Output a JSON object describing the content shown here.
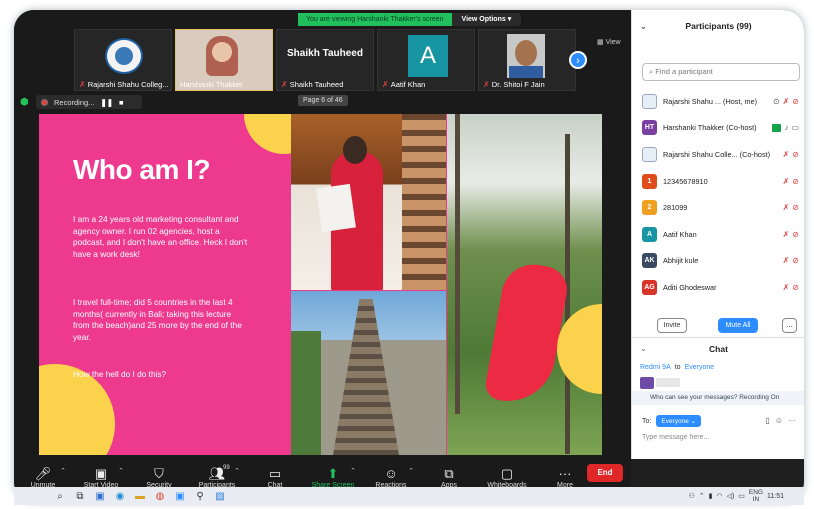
{
  "share_banner": {
    "message": "You are viewing Harshanki Thakker's screen",
    "options_label": "View Options ▾"
  },
  "video_strip": [
    {
      "name": "Rajarshi Shahu Colleg..."
    },
    {
      "name": "Harshanki Thakker"
    },
    {
      "name": "Shaikh Tauheed",
      "display": "Shaikh Tauheed"
    },
    {
      "name": "Aatif Khan",
      "avatar_letter": "A"
    },
    {
      "name": "Dr. Shitoi F Jain"
    }
  ],
  "view_label": "View",
  "recording": {
    "label": "Recording..."
  },
  "page_indicator": "Page 6 of 46",
  "slide": {
    "title": "Who am I?",
    "para1": "I am a 24 years old marketing consultant and agency owner. I run 02 agencies, host a podcast, and I don't have an office. Heck I don't have a work desk!",
    "para2": "I travel full-time; did 5 countries in the last 4 months( currently in Bali; taking this lecture from the beach)and 25 more by the end of the year.",
    "para3": "How the hell do I do this?"
  },
  "toolbar": {
    "unmute": "Unmute",
    "start_video": "Start Video",
    "security": "Security",
    "participants": "Participants",
    "participants_count": "99",
    "chat": "Chat",
    "share_screen": "Share Screen",
    "reactions": "Reactions",
    "apps": "Apps",
    "whiteboards": "Whiteboards",
    "more": "More",
    "end": "End"
  },
  "participants_panel": {
    "title": "Participants (99)",
    "search_placeholder": "Find a participant",
    "list": [
      {
        "avatar": "",
        "name": "Rajarshi Shahu ... (Host, me)",
        "color": "#ffffff"
      },
      {
        "avatar": "HT",
        "name": "Harshanki Thakker (Co-host)",
        "color": "#7a3fa0"
      },
      {
        "avatar": "",
        "name": "Rajarshi Shahu Colle... (Co-host)",
        "color": "#ffffff"
      },
      {
        "avatar": "1",
        "name": "12345678910",
        "color": "#e04d1a"
      },
      {
        "avatar": "2",
        "name": "281099",
        "color": "#f0a020"
      },
      {
        "avatar": "A",
        "name": "Aatif Khan",
        "color": "#1795a3"
      },
      {
        "avatar": "AK",
        "name": "Abhijit kule",
        "color": "#3b4a63"
      },
      {
        "avatar": "AG",
        "name": "Aditi Ghodeswar",
        "color": "#d8342a"
      }
    ],
    "invite": "Invite",
    "mute_all": "Mute All",
    "more": "..."
  },
  "chat_panel": {
    "title": "Chat",
    "from": "Redmi 9A",
    "to_word": "to",
    "to": "Everyone",
    "note": "Who can see your messages? Recording On",
    "to_label": "To:",
    "recipient": "Everyone ⌄",
    "input_placeholder": "Type message here..."
  },
  "taskbar": {
    "lang": "ENG",
    "lang2": "IN",
    "time": "11:51"
  }
}
